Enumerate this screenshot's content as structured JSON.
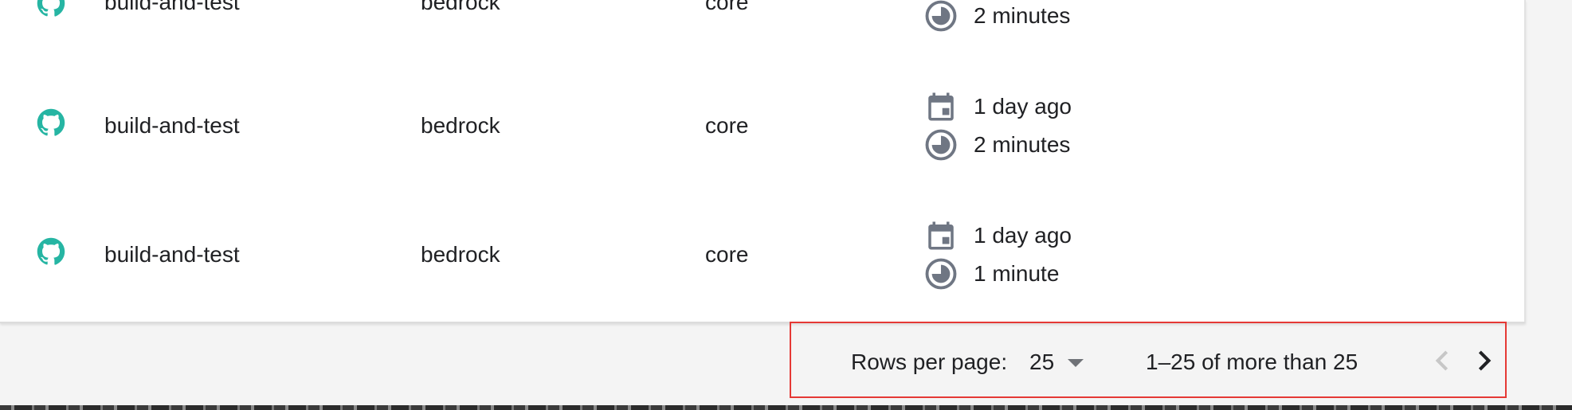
{
  "colors": {
    "github_icon": "#26b5a3",
    "meta_icon": "#6f7683",
    "pager_highlight": "#e53935",
    "disabled_nav": "#c7c7c7",
    "enabled_nav": "#202124"
  },
  "rows": [
    {
      "icon": "github-icon",
      "workflow": "build-and-test",
      "repo": "bedrock",
      "branch": "core",
      "started": "",
      "duration": "2 minutes"
    },
    {
      "icon": "github-icon",
      "workflow": "build-and-test",
      "repo": "bedrock",
      "branch": "core",
      "started": "1 day ago",
      "duration": "2 minutes"
    },
    {
      "icon": "github-icon",
      "workflow": "build-and-test",
      "repo": "bedrock",
      "branch": "core",
      "started": "1 day ago",
      "duration": "1 minute"
    }
  ],
  "pagination": {
    "rows_per_page_label": "Rows per page:",
    "rows_per_page_value": "25",
    "range_text": "1–25 of more than 25",
    "prev_enabled": false,
    "next_enabled": true
  }
}
